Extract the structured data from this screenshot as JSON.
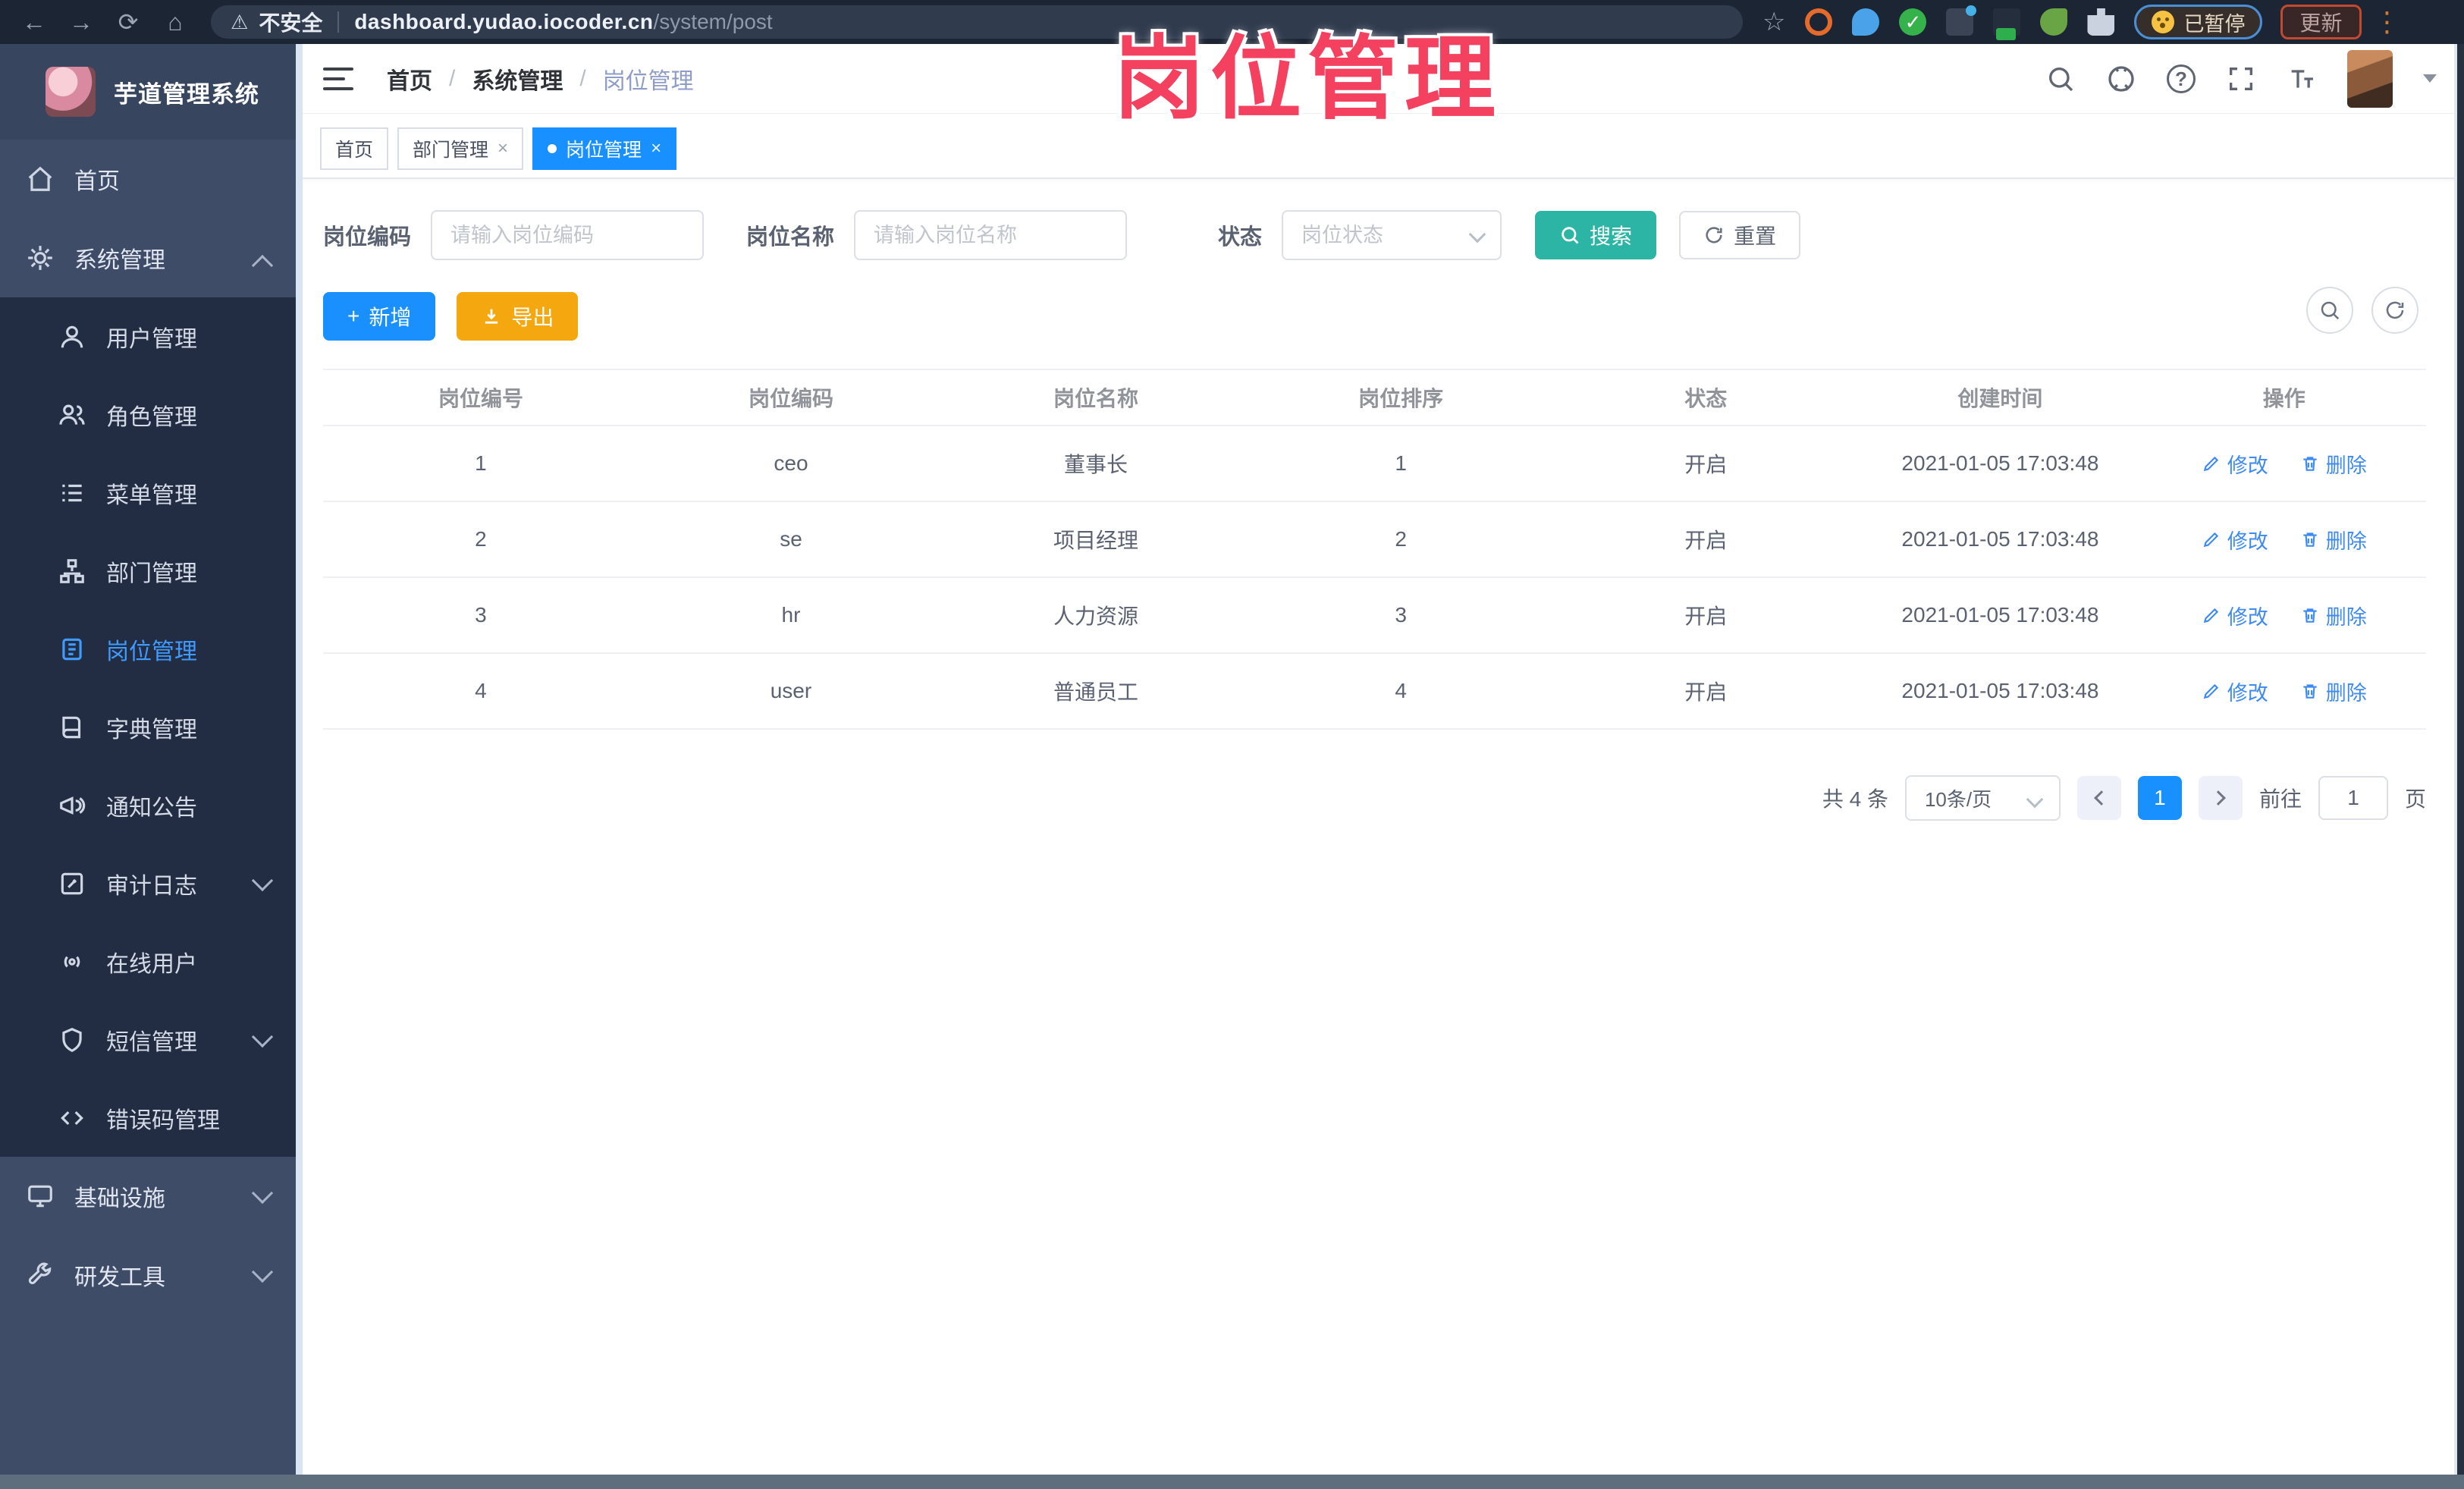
{
  "browser": {
    "security_label": "不安全",
    "url_host": "dashboard.yudao.iocoder.cn",
    "url_path": "/system/post",
    "paused_label": "已暂停",
    "update_label": "更新"
  },
  "glyphs": {
    "back": "←",
    "forward": "→",
    "reload": "⟳",
    "home": "⌂",
    "warning": "⚠",
    "star": "☆",
    "kebab": "⋮",
    "check": "✓",
    "close": "×",
    "plus": "+",
    "slash": "/",
    "question": "?"
  },
  "watermark": "岗位管理",
  "sidebar": {
    "app_title": "芋道管理系统",
    "root_home": "首页",
    "root_system": "系统管理",
    "sub_items": [
      "用户管理",
      "角色管理",
      "菜单管理",
      "部门管理",
      "岗位管理",
      "字典管理",
      "通知公告",
      "审计日志",
      "在线用户",
      "短信管理",
      "错误码管理"
    ],
    "root_infra": "基础设施",
    "root_dev": "研发工具"
  },
  "breadcrumb": [
    "首页",
    "系统管理",
    "岗位管理"
  ],
  "tabs": [
    {
      "label": "首页"
    },
    {
      "label": "部门管理"
    },
    {
      "label": "岗位管理"
    }
  ],
  "filters": {
    "fields": [
      {
        "label": "岗位编码",
        "placeholder": "请输入岗位编码"
      },
      {
        "label": "岗位名称",
        "placeholder": "请输入岗位名称"
      },
      {
        "label": "状态",
        "placeholder": "岗位状态"
      }
    ],
    "search_label": "搜索",
    "reset_label": "重置"
  },
  "toolbar": {
    "add_label": "新增",
    "export_label": "导出"
  },
  "table": {
    "columns": [
      "岗位编号",
      "岗位编码",
      "岗位名称",
      "岗位排序",
      "状态",
      "创建时间",
      "操作"
    ],
    "op_edit": "修改",
    "op_delete": "删除",
    "rows": [
      {
        "id": "1",
        "code": "ceo",
        "name": "董事长",
        "sort": "1",
        "status": "开启",
        "created": "2021-01-05 17:03:48"
      },
      {
        "id": "2",
        "code": "se",
        "name": "项目经理",
        "sort": "2",
        "status": "开启",
        "created": "2021-01-05 17:03:48"
      },
      {
        "id": "3",
        "code": "hr",
        "name": "人力资源",
        "sort": "3",
        "status": "开启",
        "created": "2021-01-05 17:03:48"
      },
      {
        "id": "4",
        "code": "user",
        "name": "普通员工",
        "sort": "4",
        "status": "开启",
        "created": "2021-01-05 17:03:48"
      }
    ]
  },
  "pagination": {
    "total": "共 4 条",
    "page_size": "10条/页",
    "current": "1",
    "goto_label": "前往",
    "goto_value": "1",
    "page_unit": "页"
  },
  "colors": {
    "accent_blue": "#1890ff",
    "search_teal": "#2cb5a5",
    "export_orange": "#f5a70f",
    "watermark_pink": "#f4415f",
    "sidebar_bg": "#3e4c68",
    "submenu_bg": "#222d43"
  }
}
